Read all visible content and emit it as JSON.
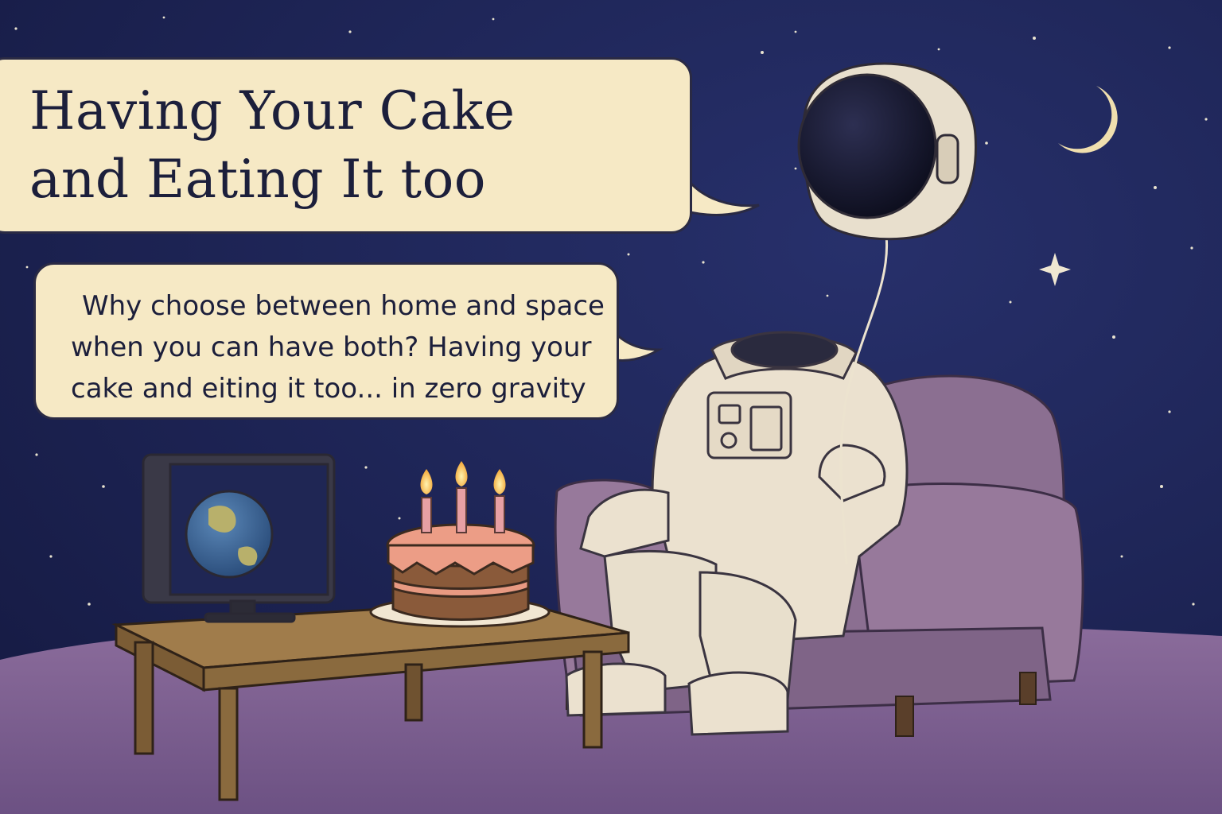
{
  "title": {
    "lines": [
      "Having Your Cake",
      "and Eating It too"
    ]
  },
  "caption": {
    "lines": [
      "Why choose between home and space",
      "when you can have both? Having your",
      "cake and eiting it too... in zero gravity"
    ]
  },
  "scene": {
    "elements": [
      "night-sky",
      "crescent-moon",
      "stars",
      "floating-helmet-balloon",
      "headless-spacesuit",
      "armchair",
      "coffee-table",
      "birthday-cake",
      "candles",
      "tv-showing-earth"
    ],
    "candle_count": 3
  },
  "colors": {
    "sky": "#1b2150",
    "bubble": "#f6e9c5",
    "text": "#1c1f3b",
    "armchair": "#8a6f8e",
    "floor": "#7b5f8e",
    "table": "#8a6a3e",
    "cake_frosting": "#e8907a"
  }
}
